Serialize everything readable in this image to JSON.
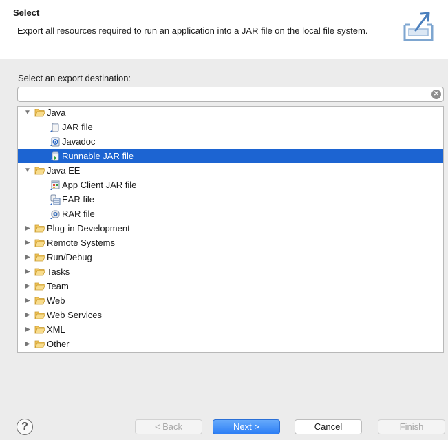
{
  "header": {
    "title": "Select",
    "description": "Export all resources required to run an application into a JAR file on the local file system."
  },
  "destination": {
    "label": "Select an export destination:",
    "filter_value": "",
    "filter_placeholder": ""
  },
  "tree": {
    "java": {
      "label": "Java",
      "expanded": true
    },
    "jar_file": "JAR file",
    "javadoc": "Javadoc",
    "runnable_jar": "Runnable JAR file",
    "java_ee": {
      "label": "Java EE",
      "expanded": true
    },
    "app_client_jar": "App Client JAR file",
    "ear_file": "EAR file",
    "rar_file": "RAR file",
    "plugin_dev": "Plug-in Development",
    "remote_systems": "Remote Systems",
    "run_debug": "Run/Debug",
    "tasks": "Tasks",
    "team": "Team",
    "web": "Web",
    "web_services": "Web Services",
    "xml": "XML",
    "other": "Other",
    "selected": "Runnable JAR file"
  },
  "buttons": {
    "back": "< Back",
    "next": "Next >",
    "cancel": "Cancel",
    "finish": "Finish"
  },
  "colors": {
    "selection": "#1c64d2",
    "default_button": "#2c7ef5",
    "folder": "#f5cf6a"
  }
}
